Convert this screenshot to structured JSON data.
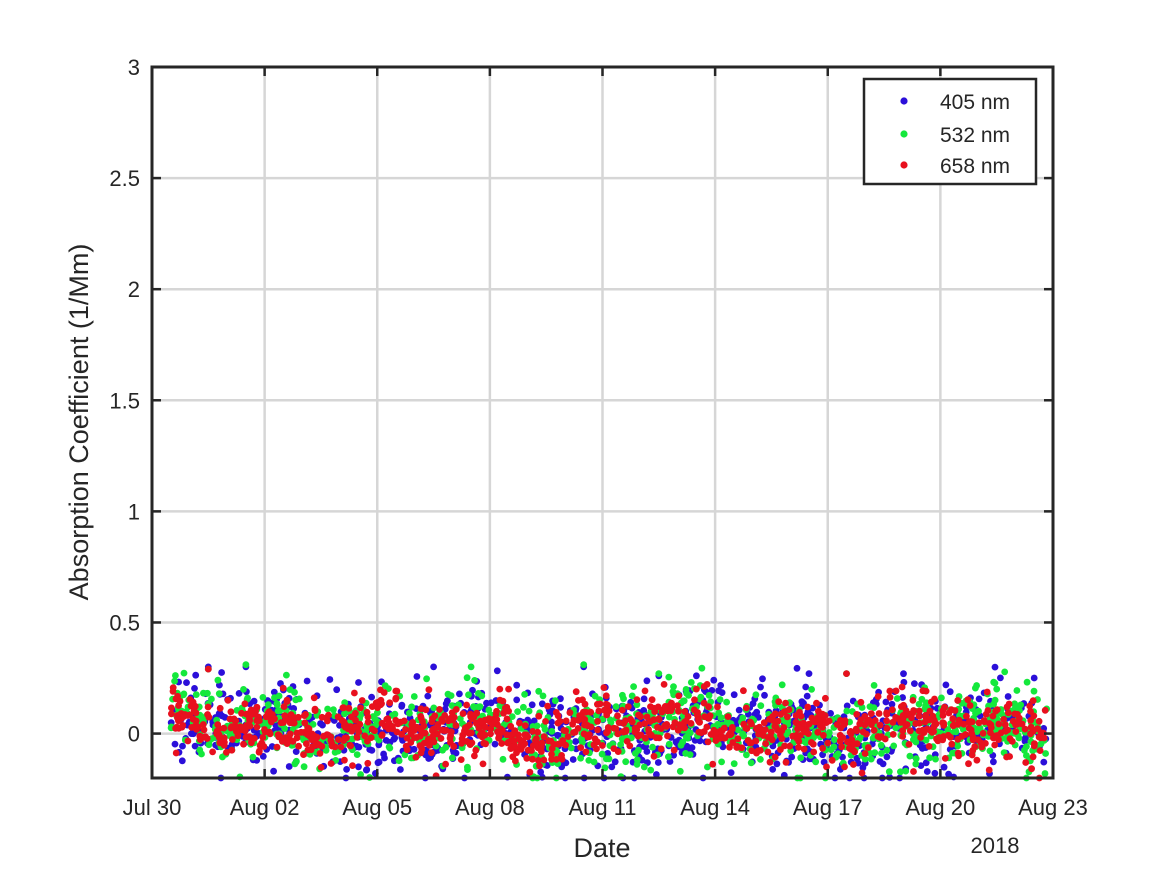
{
  "chart_data": {
    "type": "scatter",
    "xlabel": "Date",
    "ylabel": "Absorption Coefficient (1/Mm)",
    "x_year_label": "2018",
    "xlim": [
      "2018-07-30",
      "2018-08-23"
    ],
    "ylim": [
      -0.2,
      3
    ],
    "x_ticks": [
      "2018-07-30",
      "2018-08-02",
      "2018-08-05",
      "2018-08-08",
      "2018-08-11",
      "2018-08-14",
      "2018-08-17",
      "2018-08-20",
      "2018-08-23"
    ],
    "x_tick_labels": [
      "Jul 30",
      "Aug 02",
      "Aug 05",
      "Aug 08",
      "Aug 11",
      "Aug 14",
      "Aug 17",
      "Aug 20",
      "Aug 23"
    ],
    "y_ticks": [
      0,
      0.5,
      1,
      1.5,
      2,
      2.5,
      3
    ],
    "y_tick_labels": [
      "0",
      "0.5",
      "1",
      "1.5",
      "2",
      "2.5",
      "3"
    ],
    "grid": true,
    "legend_position": "top-right",
    "data_start": "2018-07-30T12:00",
    "data_end": "2018-08-22T20:00",
    "series": [
      {
        "name": "405 nm",
        "color": "#2b0fd9",
        "typical_range": [
          -0.2,
          0.32
        ],
        "x": [
          "2018-07-31",
          "2018-08-01",
          "2018-08-04",
          "2018-08-06",
          "2018-08-10",
          "2018-08-12",
          "2018-08-13",
          "2018-08-16",
          "2018-08-19",
          "2018-08-22"
        ],
        "y": [
          0.3,
          0.3,
          0.23,
          0.3,
          0.3,
          0.26,
          0.26,
          0.27,
          0.22,
          0.25
        ]
      },
      {
        "name": "532 nm",
        "color": "#14e83c",
        "typical_range": [
          -0.2,
          0.32
        ],
        "x": [
          "2018-07-31",
          "2018-08-01",
          "2018-08-07",
          "2018-08-10",
          "2018-08-12",
          "2018-08-17",
          "2018-08-21"
        ],
        "y": [
          0.29,
          0.31,
          0.3,
          0.31,
          0.27,
          0.27,
          0.2
        ]
      },
      {
        "name": "658 nm",
        "color": "#e8101e",
        "typical_range": [
          -0.2,
          0.3
        ],
        "x": [
          "2018-07-31",
          "2018-08-08",
          "2018-08-13",
          "2018-08-17"
        ],
        "y": [
          0.29,
          0.2,
          0.2,
          0.27
        ]
      }
    ]
  }
}
